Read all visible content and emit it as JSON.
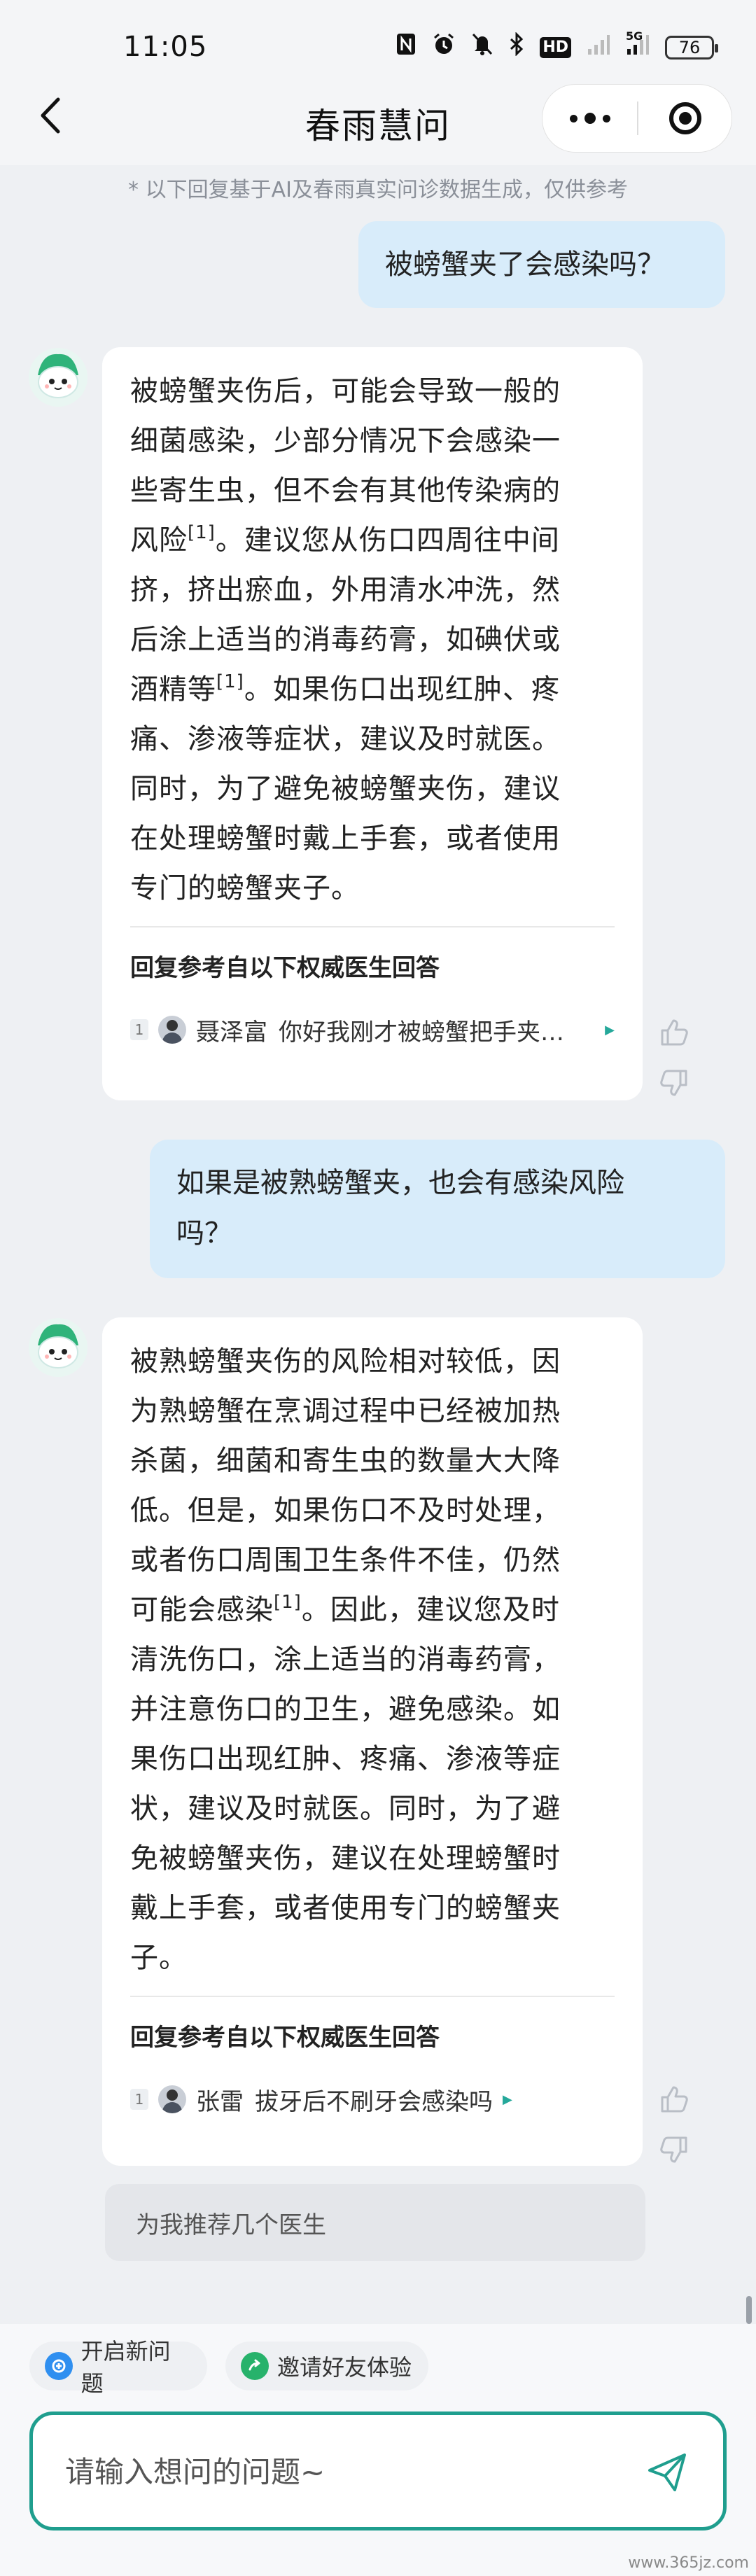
{
  "status_bar": {
    "time": "11:05",
    "icons": [
      "nfc-icon",
      "alarm-icon",
      "mute-icon",
      "bluetooth-icon",
      "hd-icon",
      "signal-icon",
      "5g-signal-icon"
    ],
    "hd_label": "HD",
    "network_label": "5G",
    "battery": "76"
  },
  "header": {
    "title": "春雨慧问"
  },
  "disclaimer": "* 以下回复基于AI及春雨真实问诊数据生成，仅供参考",
  "conversation": [
    {
      "role": "user",
      "text": "被螃蟹夹了会感染吗？"
    },
    {
      "role": "bot",
      "lines": [
        "被螃蟹夹伤后，可能会导致一般的",
        "细菌感染，少部分情况下会感染一",
        "些寄生虫，但不会有其他传染病的",
        "风险",
        "。建议您从伤口四周往中间",
        "挤，挤出瘀血，外用清水冲洗，然",
        "后涂上适当的消毒药膏，如碘伏或",
        "酒精等",
        "。如果伤口出现红肿、疼",
        "痛、渗液等症状，建议及时就医。",
        "同时，为了避免被螃蟹夹伤，建议",
        "在处理螃蟹时戴上手套，或者使用",
        "专门的螃蟹夹子。"
      ],
      "citation_marks": [
        "[1]",
        "[1]"
      ],
      "reference_title": "回复参考自以下权威医生回答",
      "reference": {
        "index": "1",
        "doctor": "聂泽富",
        "question": "你好我刚才被螃蟹把手夹…"
      }
    },
    {
      "role": "user",
      "lines": [
        "如果是被熟螃蟹夹，也会有感染风险",
        "吗？"
      ]
    },
    {
      "role": "bot",
      "lines": [
        "被熟螃蟹夹伤的风险相对较低，因",
        "为熟螃蟹在烹调过程中已经被加热",
        "杀菌，细菌和寄生虫的数量大大降",
        "低。但是，如果伤口不及时处理，",
        "或者伤口周围卫生条件不佳，仍然",
        "可能会感染",
        "。因此，建议您及时",
        "清洗伤口，涂上适当的消毒药膏，",
        "并注意伤口的卫生，避免感染。如",
        "果伤口出现红肿、疼痛、渗液等症",
        "状，建议及时就医。同时，为了避",
        "免被螃蟹夹伤，建议在处理螃蟹时",
        "戴上手套，或者使用专门的螃蟹夹",
        "子。"
      ],
      "citation_marks": [
        "[1]"
      ],
      "reference_title": "回复参考自以下权威医生回答",
      "reference": {
        "index": "1",
        "doctor": "张雷",
        "question": "拔牙后不刷牙会感染吗"
      }
    }
  ],
  "suggestion": "为我推荐几个医生",
  "chips": {
    "new_question": "开启新问题",
    "invite": "邀请好友体验"
  },
  "input": {
    "placeholder": "请输入想问的问题~",
    "value": ""
  },
  "watermark": "www.365jz.com",
  "colors": {
    "accent": "#1f9e8e",
    "user_bubble": "#d8ecfa",
    "background": "#eef0f3"
  }
}
